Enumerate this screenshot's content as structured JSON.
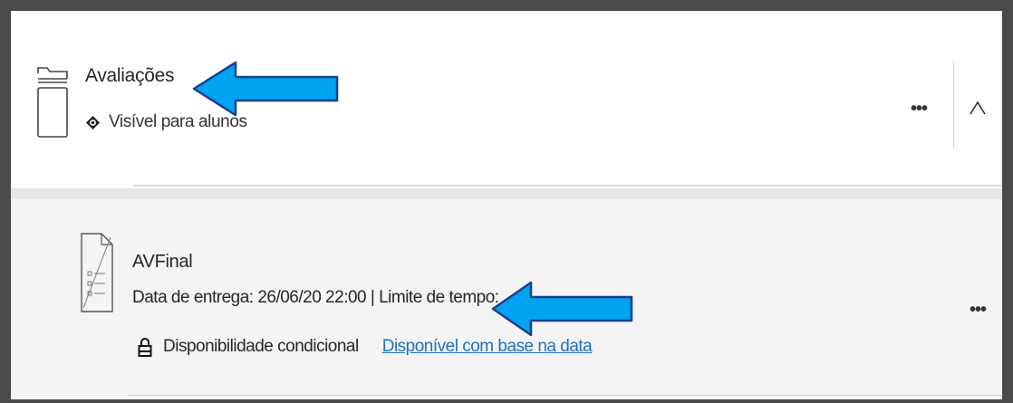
{
  "folder": {
    "title": "Avaliações",
    "visibility": "Visível para alunos",
    "more_label": "•••"
  },
  "item": {
    "title": "AVFinal",
    "meta": "Data de entrega: 26/06/20 22:00 | Limite de tempo:",
    "condition_label": "Disponibilidade condicional",
    "condition_link": "Disponível com base na data",
    "more_label": "•••"
  },
  "icons": {
    "folder": "folder-icon",
    "visibility": "eye-icon",
    "collapse": "chevron-up-icon",
    "document": "test-document-icon",
    "condition": "lock-icon"
  },
  "colors": {
    "link": "#1f6fbf",
    "annotation_arrow": "#00a3ef",
    "frame": "#4a4a4a",
    "item_background": "#f4f4f4"
  }
}
